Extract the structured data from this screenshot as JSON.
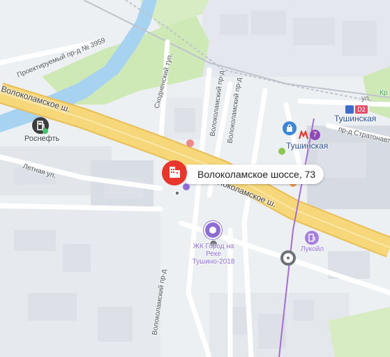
{
  "map": {
    "selected_address": "Волоколамское шоссе, 73",
    "roads": {
      "volokolamskoe_upper": "Волоколамское ш.",
      "volokolamskoe_lower": "Волоколамское ш.",
      "letnyaya": "Летная ул.",
      "proektiruemy": "Проектируемый пр-д № 3959",
      "skhodnensky": "Сходненский туп.",
      "volokolamsky_proezd_1": "Волоколамский пр-д",
      "volokolamsky_proezd_2": "Волоколамский пр-д",
      "volokolamsky_proezd_3": "Волоколамский пр-д",
      "stratonavtov": "пр-д Стратонавтов",
      "ul_partial": "ул."
    },
    "pois": {
      "rosneft": "Роснефть",
      "tushinskaya_metro": "Тушинская",
      "tushinskaya_d2": "Тушинская",
      "d2_badge": "D2",
      "metro_line": "7",
      "lukoil": "Лукойл",
      "zhk": "ЖК Город на Реке Тушино-2018",
      "park_partial": "Кр Ок"
    },
    "colors": {
      "highway": "#f6d77a",
      "highway_edge": "#e9bf55",
      "water": "#a8d3f0",
      "park": "#cfe9b6",
      "railway": "#b9b0d6",
      "metro_line": "#a36cd1",
      "pin": "#e8362c",
      "purple_poi": "#8e6cd6",
      "gray_poi": "#6d7074",
      "rosneft_poi": "#3c3c3c",
      "d2_badge": "#e64d6a"
    },
    "icons": {
      "selected_pin": "building-pin-icon",
      "rosneft": "fuel-station-icon",
      "lukoil": "fuel-station-icon",
      "metro": "metro-icon",
      "shopping": "shopping-bag-icon",
      "zhk": "residential-complex-icon"
    }
  }
}
